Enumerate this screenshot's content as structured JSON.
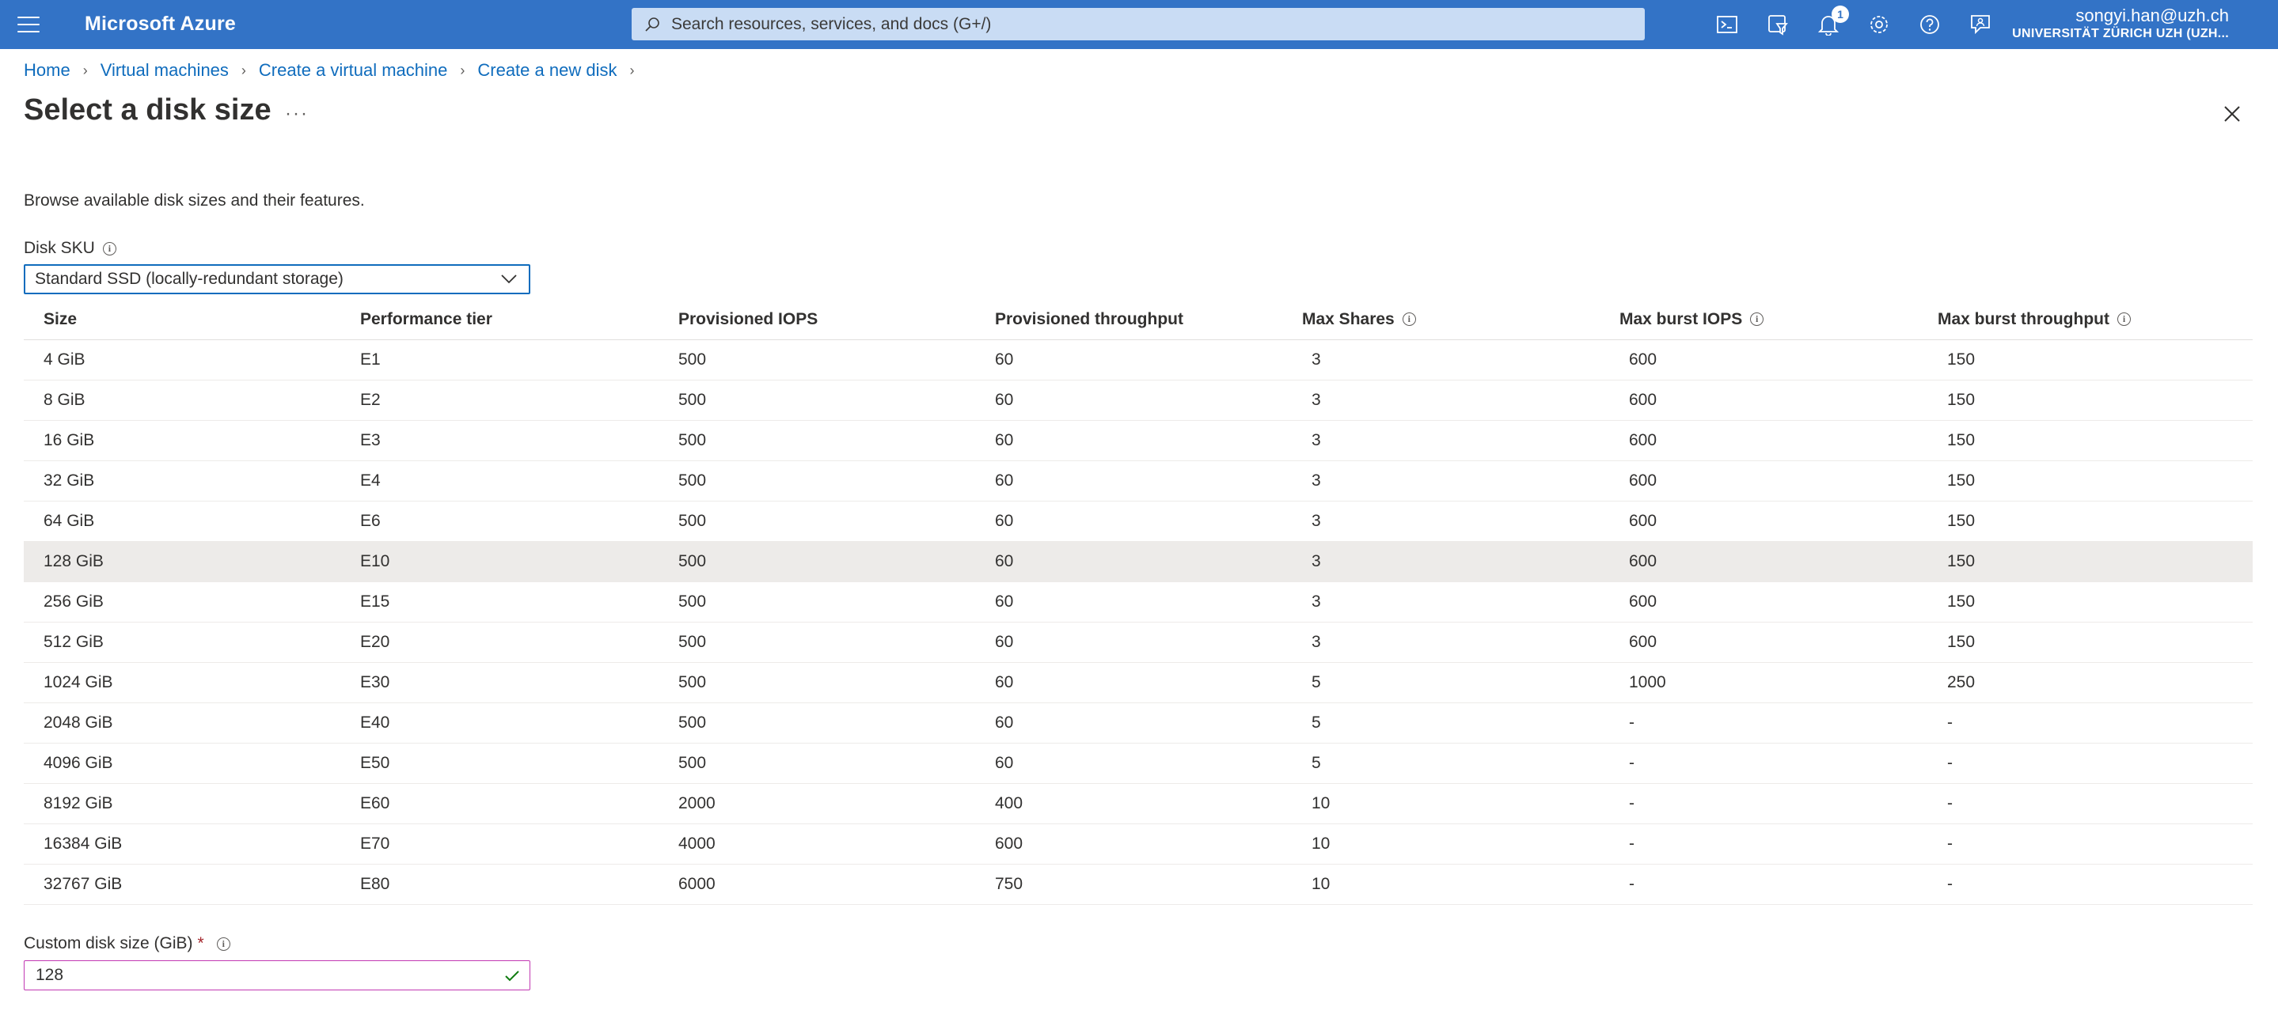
{
  "topbar": {
    "brand": "Microsoft Azure",
    "search_placeholder": "Search resources, services, and docs (G+/)",
    "notification_count": "1",
    "account_user": "songyi.han@uzh.ch",
    "account_org": "UNIVERSITÄT ZÜRICH UZH (UZH...",
    "icons": [
      "cloud-shell-icon",
      "directory-filter-icon",
      "notifications-icon",
      "settings-icon",
      "help-icon",
      "feedback-icon"
    ],
    "accent_color": "#3373c6"
  },
  "breadcrumb": [
    "Home",
    "Virtual machines",
    "Create a virtual machine",
    "Create a new disk"
  ],
  "page": {
    "title": "Select a disk size",
    "more": "···",
    "description": "Browse available disk sizes and their features."
  },
  "disk_sku": {
    "label": "Disk SKU",
    "selected": "Standard SSD (locally-redundant storage)"
  },
  "table": {
    "headers": [
      "Size",
      "Performance tier",
      "Provisioned IOPS",
      "Provisioned throughput",
      "Max Shares",
      "Max burst IOPS",
      "Max burst throughput"
    ],
    "selected_row_index": 5,
    "rows": [
      [
        "4 GiB",
        "E1",
        "500",
        "60",
        "3",
        "600",
        "150"
      ],
      [
        "8 GiB",
        "E2",
        "500",
        "60",
        "3",
        "600",
        "150"
      ],
      [
        "16 GiB",
        "E3",
        "500",
        "60",
        "3",
        "600",
        "150"
      ],
      [
        "32 GiB",
        "E4",
        "500",
        "60",
        "3",
        "600",
        "150"
      ],
      [
        "64 GiB",
        "E6",
        "500",
        "60",
        "3",
        "600",
        "150"
      ],
      [
        "128 GiB",
        "E10",
        "500",
        "60",
        "3",
        "600",
        "150"
      ],
      [
        "256 GiB",
        "E15",
        "500",
        "60",
        "3",
        "600",
        "150"
      ],
      [
        "512 GiB",
        "E20",
        "500",
        "60",
        "3",
        "600",
        "150"
      ],
      [
        "1024 GiB",
        "E30",
        "500",
        "60",
        "5",
        "1000",
        "250"
      ],
      [
        "2048 GiB",
        "E40",
        "500",
        "60",
        "5",
        "-",
        "-"
      ],
      [
        "4096 GiB",
        "E50",
        "500",
        "60",
        "5",
        "-",
        "-"
      ],
      [
        "8192 GiB",
        "E60",
        "2000",
        "400",
        "10",
        "-",
        "-"
      ],
      [
        "16384 GiB",
        "E70",
        "4000",
        "600",
        "10",
        "-",
        "-"
      ],
      [
        "32767 GiB",
        "E80",
        "6000",
        "750",
        "10",
        "-",
        "-"
      ]
    ]
  },
  "custom_size": {
    "label": "Custom disk size (GiB)",
    "required_mark": "*",
    "value": "128"
  }
}
